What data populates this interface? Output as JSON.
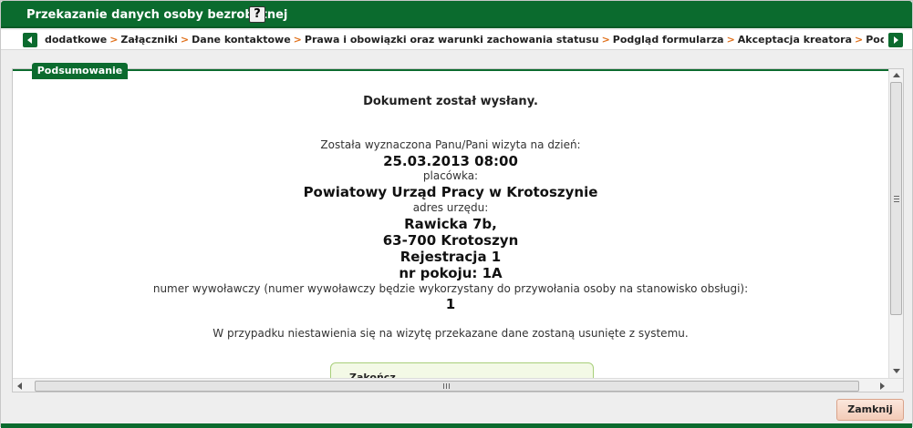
{
  "dialog": {
    "title": "Przekazanie danych osoby bezrobotnej",
    "help_label": "?"
  },
  "breadcrumb": {
    "items": [
      "dodatkowe",
      "Załączniki",
      "Dane kontaktowe",
      "Prawa i obowiązki oraz warunki zachowania statusu",
      "Podgląd formularza",
      "Akceptacja kreatora",
      "Podsumowanie"
    ],
    "separator": ">"
  },
  "section": {
    "tab_label": "Podsumowanie"
  },
  "summary": {
    "sent_message": "Dokument został wysłany.",
    "visit_label": "Została wyznaczona Panu/Pani wizyta na dzień:",
    "visit_datetime": "25.03.2013 08:00",
    "office_label": "placówka:",
    "office_name": "Powiatowy Urząd Pracy w Krotoszynie",
    "address_label": "adres urzędu:",
    "address_line1": "Rawicka 7b,",
    "address_line2": "63-700 Krotoszyn",
    "address_line3": "Rejestracja 1",
    "room": "nr pokoju: 1A",
    "call_number_label": "numer wywoławczy (numer wywoławczy będzie wykorzystany do przywołania osoby na stanowisko obsługi):",
    "call_number": "1",
    "warning": "W przypadku niestawienia się na wizytę przekazane dane zostaną usunięte z systemu."
  },
  "finish_box": {
    "label": "Zakończ"
  },
  "footer": {
    "close_label": "Zamknij"
  },
  "colors": {
    "brand_green": "#0b6b2e",
    "separator_orange": "#e0711c",
    "close_button_bg": "#f3cbb7"
  }
}
